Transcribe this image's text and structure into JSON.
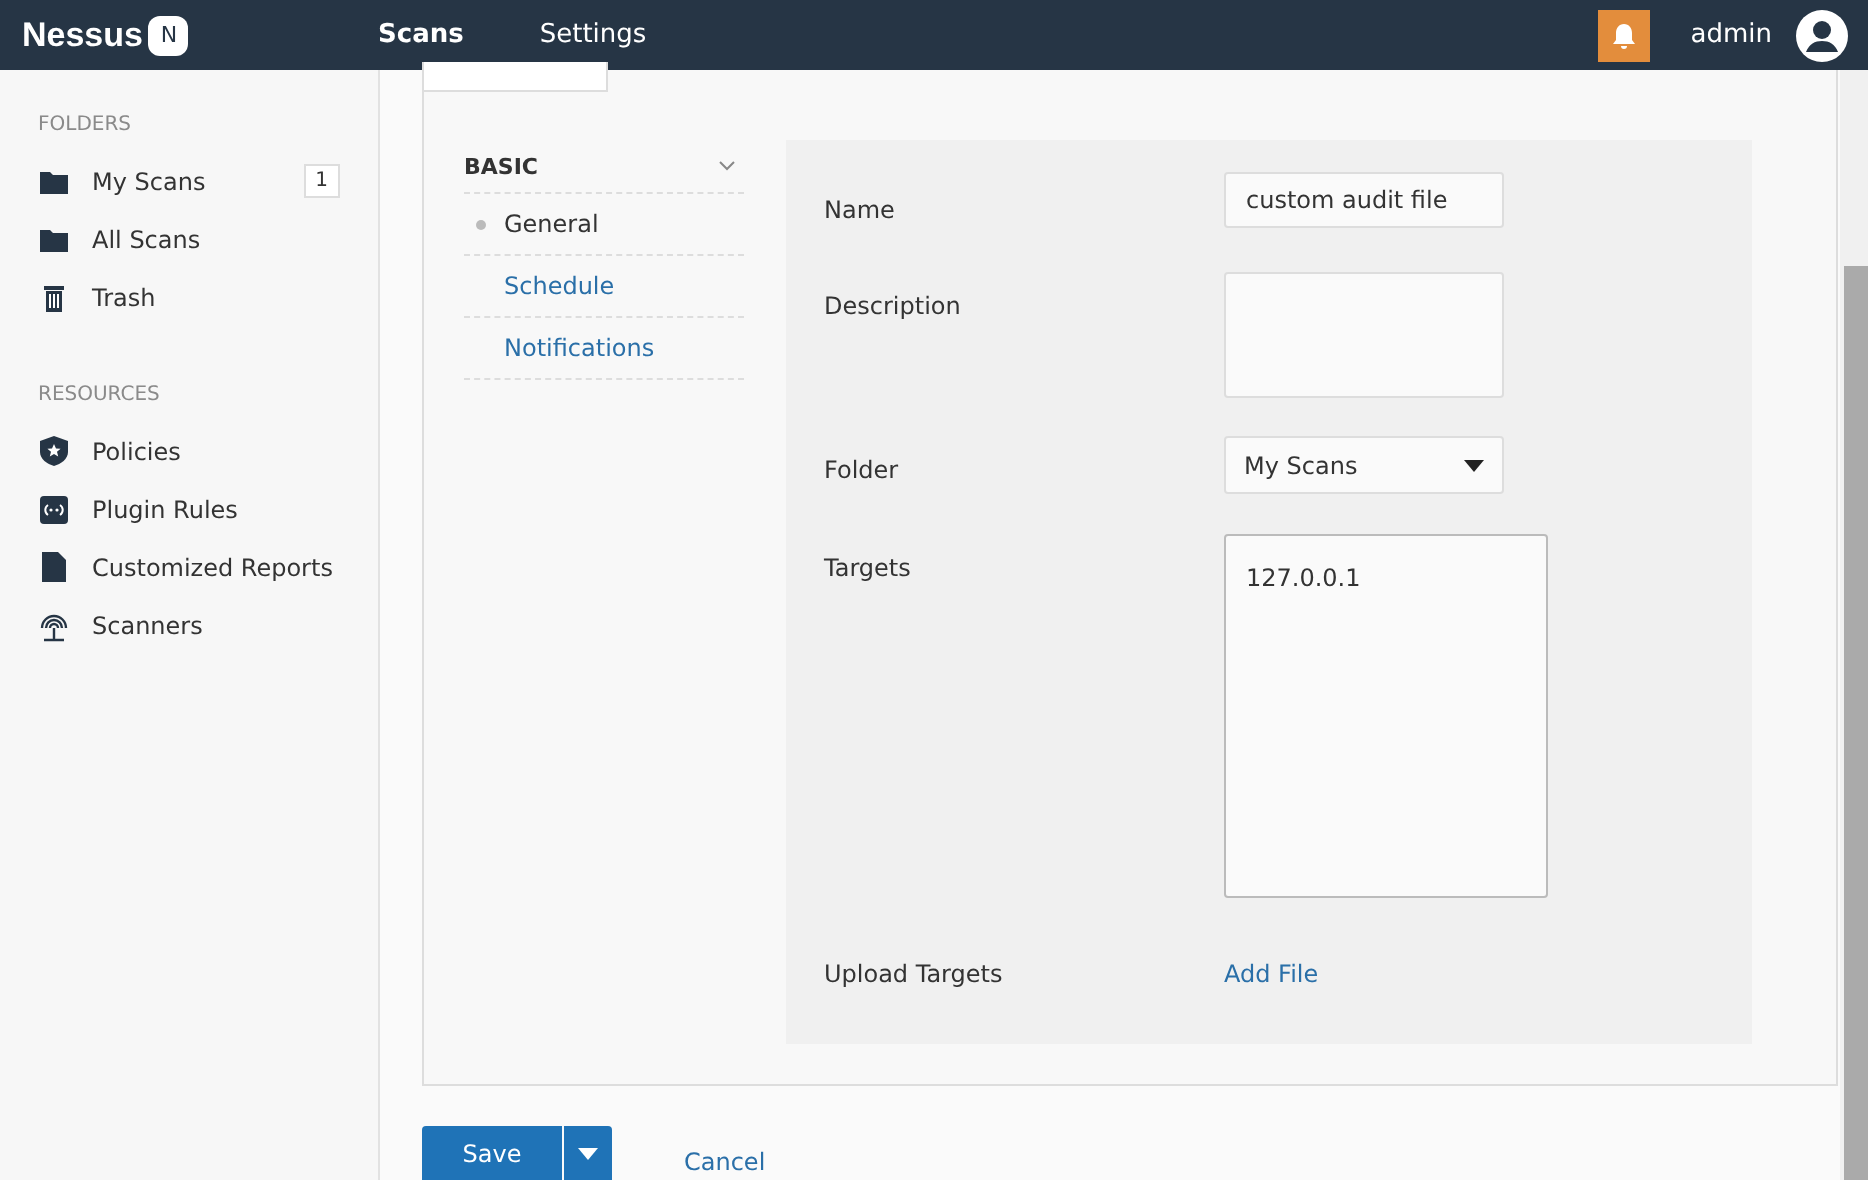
{
  "topbar": {
    "logo": "Nessus",
    "logo_badge": "N",
    "nav": [
      {
        "label": "Scans",
        "selected": true
      },
      {
        "label": "Settings",
        "selected": false
      }
    ],
    "user": "admin"
  },
  "sidebar": {
    "sections": [
      {
        "title": "FOLDERS",
        "items": [
          {
            "label": "My Scans",
            "kind": "folder",
            "count": "1"
          },
          {
            "label": "All Scans",
            "kind": "folder"
          },
          {
            "label": "Trash",
            "kind": "trash"
          }
        ]
      },
      {
        "title": "RESOURCES",
        "items": [
          {
            "label": "Policies",
            "kind": "shield"
          },
          {
            "label": "Plugin Rules",
            "kind": "plug"
          },
          {
            "label": "Customized Reports",
            "kind": "doc"
          },
          {
            "label": "Scanners",
            "kind": "radar"
          }
        ]
      }
    ]
  },
  "settings_nav": {
    "group": "BASIC",
    "expanded": true,
    "items": [
      {
        "label": "General",
        "selected": true
      },
      {
        "label": "Schedule",
        "selected": false
      },
      {
        "label": "Notifications",
        "selected": false
      }
    ]
  },
  "form": [
    {
      "kind": "text",
      "label": "Name",
      "value": "custom audit file"
    },
    {
      "kind": "textarea",
      "label": "Description"
    },
    {
      "kind": "select",
      "label": "Folder",
      "value": "My Scans"
    },
    {
      "kind": "bigtext",
      "label": "Targets",
      "value": "127.0.0.1"
    },
    {
      "kind": "link",
      "label": "Upload Targets",
      "value": "Add File"
    }
  ],
  "buttons": {
    "save": "Save",
    "cancel": "Cancel"
  }
}
